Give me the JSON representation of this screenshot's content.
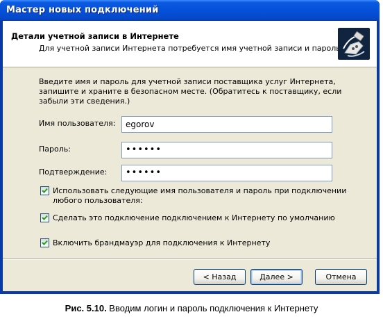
{
  "window": {
    "title": "Мастер новых подключений"
  },
  "header": {
    "title": "Детали учетной записи в Интернете",
    "subtitle": "Для учетной записи Интернета потребуется имя учетной записи и пароль.",
    "icon": "phone-connection-icon"
  },
  "intro_text": "Введите имя и пароль для учетной записи поставщика услуг Интернета, запишите и храните в безопасном месте. (Обратитесь к поставщику, если забыли эти сведения.)",
  "fields": {
    "username": {
      "label": "Имя пользователя:",
      "value": "egorov"
    },
    "password": {
      "label": "Пароль:",
      "value": "••••••"
    },
    "confirm": {
      "label": "Подтверждение:",
      "value": "••••••"
    }
  },
  "checkboxes": [
    {
      "label_line1": "Использовать следующие имя пользователя и пароль при подключении",
      "label_line2": "любого пользователя:",
      "checked": true
    },
    {
      "label_line1": "Сделать это подключение подключением к Интернету по умолчанию",
      "checked": true
    },
    {
      "label_line1": "Включить брандмауэр для подключения к Интернету",
      "checked": true
    }
  ],
  "buttons": {
    "back": "< Назад",
    "next": "Далее >",
    "cancel": "Отмена"
  },
  "caption": {
    "figure": "Рис. 5.10.",
    "text": " Вводим логин и пароль подключения к Интернету"
  },
  "colors": {
    "titlebar": "#0550d8",
    "dialog_bg": "#ece9d8",
    "input_border": "#7f9db9"
  }
}
